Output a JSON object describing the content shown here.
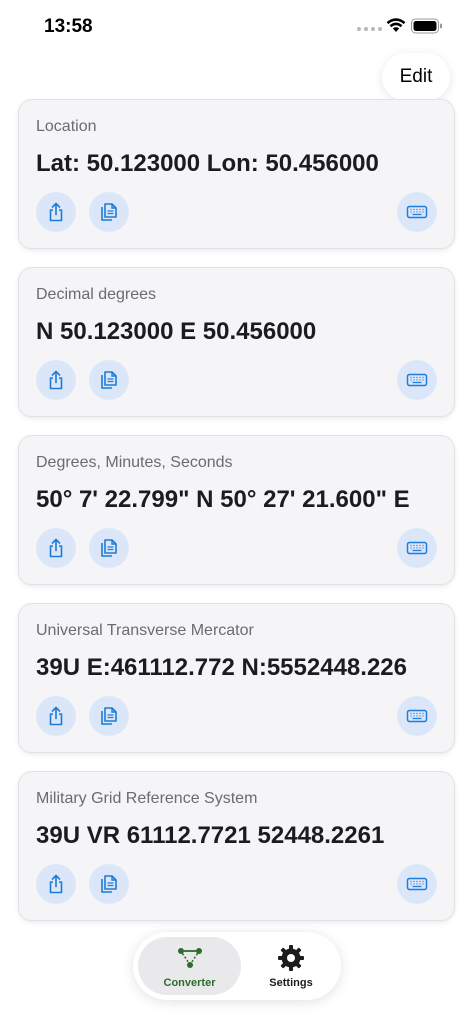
{
  "status_bar": {
    "time": "13:58"
  },
  "header": {
    "edit_label": "Edit"
  },
  "cards": [
    {
      "label": "Location",
      "value": "Lat: 50.123000 Lon: 50.456000"
    },
    {
      "label": "Decimal degrees",
      "value": "N 50.123000 E 50.456000"
    },
    {
      "label": "Degrees, Minutes, Seconds",
      "value": "50° 7' 22.799\" N 50° 27' 21.600\" E"
    },
    {
      "label": "Universal Transverse Mercator",
      "value": "39U E:461112.772 N:5552448.226"
    },
    {
      "label": "Military Grid Reference System",
      "value": "39U VR 61112.7721 52448.2261"
    }
  ],
  "card_actions": {
    "share_icon": "share-icon",
    "copy_icon": "copy-icon",
    "keyboard_icon": "keyboard-icon"
  },
  "tab_bar": {
    "tabs": [
      {
        "label": "Converter",
        "icon": "converter-icon",
        "selected": true
      },
      {
        "label": "Settings",
        "icon": "gear-icon",
        "selected": false
      }
    ]
  },
  "colors": {
    "accent": "#1e7bd8",
    "button_bg": "#dbe7f8",
    "card_bg": "#f5f5f7",
    "selected_tab": "#2e6b2e"
  }
}
